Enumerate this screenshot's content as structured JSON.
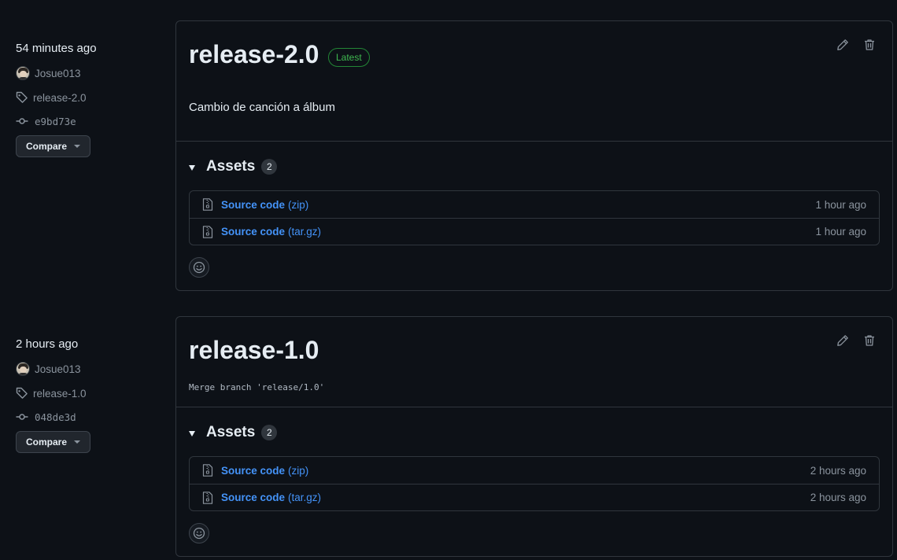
{
  "releases": [
    {
      "time_ago": "54 minutes ago",
      "author": "Josue013",
      "tag": "release-2.0",
      "commit": "e9bd73e",
      "compare_label": "Compare",
      "title": "release-2.0",
      "badge": "Latest",
      "body": "Cambio de canción a álbum",
      "assets_label": "Assets",
      "assets_count": "2",
      "assets": [
        {
          "name": "Source code",
          "ext": "(zip)",
          "age": "1 hour ago"
        },
        {
          "name": "Source code",
          "ext": "(tar.gz)",
          "age": "1 hour ago"
        }
      ]
    },
    {
      "time_ago": "2 hours ago",
      "author": "Josue013",
      "tag": "release-1.0",
      "commit": "048de3d",
      "compare_label": "Compare",
      "title": "release-1.0",
      "body": "Merge branch 'release/1.0'",
      "assets_label": "Assets",
      "assets_count": "2",
      "assets": [
        {
          "name": "Source code",
          "ext": "(zip)",
          "age": "2 hours ago"
        },
        {
          "name": "Source code",
          "ext": "(tar.gz)",
          "age": "2 hours ago"
        }
      ]
    }
  ],
  "icons": {
    "author": "avatar",
    "tag": "tag-icon",
    "commit": "git-commit-icon",
    "edit": "pencil-icon",
    "delete": "trash-icon",
    "asset": "file-zip-icon",
    "reaction": "smiley-icon"
  },
  "colors": {
    "background": "#0d1117",
    "border": "#30363d",
    "link": "#4493f8",
    "latest_badge": "#3fb950",
    "muted": "#8b949e"
  }
}
